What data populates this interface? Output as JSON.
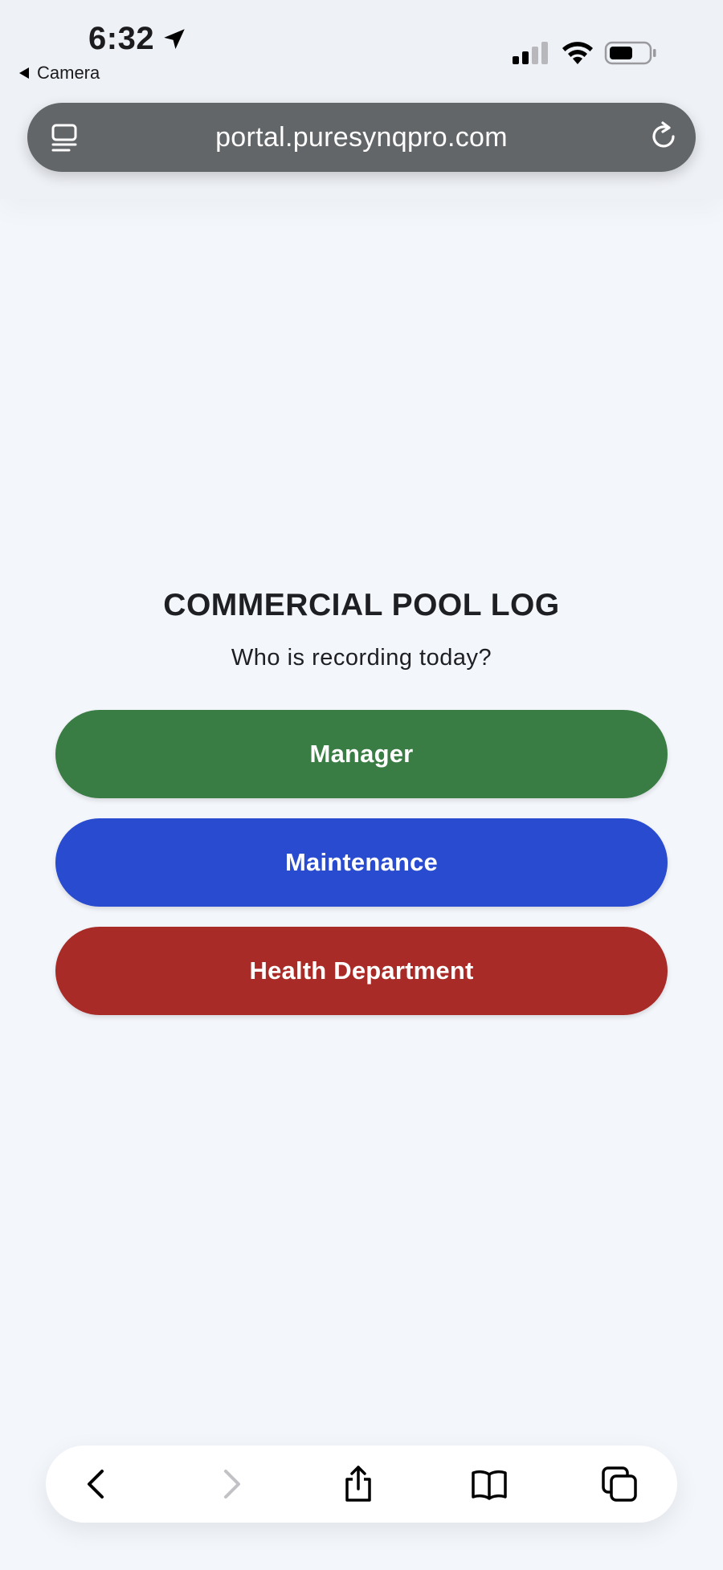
{
  "status_bar": {
    "time": "6:32",
    "back_app": "Camera"
  },
  "browser": {
    "url": "portal.puresynqpro.com"
  },
  "main": {
    "title": "COMMERCIAL POOL LOG",
    "subtitle": "Who is recording today?",
    "buttons": [
      {
        "label": "Manager",
        "color": "#3a7d44"
      },
      {
        "label": "Maintenance",
        "color": "#294bd0"
      },
      {
        "label": "Health Department",
        "color": "#a82b27"
      }
    ]
  },
  "toolbar": {
    "icons": [
      "back-icon",
      "forward-icon",
      "share-icon",
      "bookmarks-icon",
      "tabs-icon"
    ]
  }
}
